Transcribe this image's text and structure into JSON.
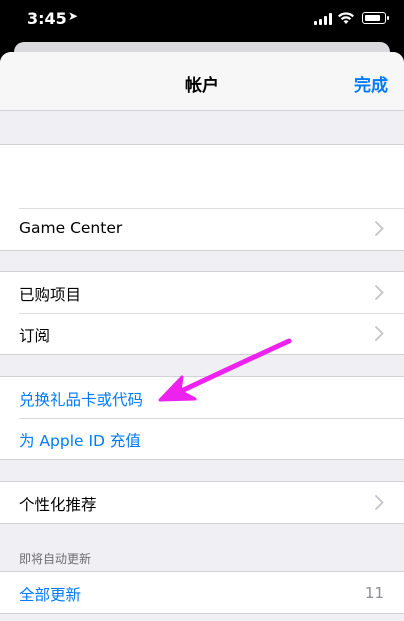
{
  "status_bar": {
    "time": "3:45",
    "location_icon": "location-arrow-icon",
    "signal_icon": "cellular-signal-icon",
    "wifi_icon": "wifi-icon",
    "battery_icon": "battery-icon",
    "battery_level": 0.85
  },
  "nav": {
    "title": "帐户",
    "done_label": "完成"
  },
  "sections": {
    "profile": {},
    "game_center": {
      "label": "Game Center"
    },
    "purchases": [
      {
        "label": "已购项目"
      },
      {
        "label": "订阅"
      }
    ],
    "gift": {
      "redeem_label": "兑换礼品卡或代码",
      "add_funds_label": "为 Apple ID 充值"
    },
    "personalized": {
      "label": "个性化推荐"
    },
    "updates": {
      "header": "即将自动更新",
      "update_all_label": "全部更新",
      "update_count": "11"
    }
  },
  "annotation": {
    "arrow_color": "#ee22ee",
    "points_to": "兑换礼品卡或代码"
  },
  "colors": {
    "accent": "#007aff",
    "background": "#efeff4",
    "secondary_text": "#8e8e93"
  }
}
